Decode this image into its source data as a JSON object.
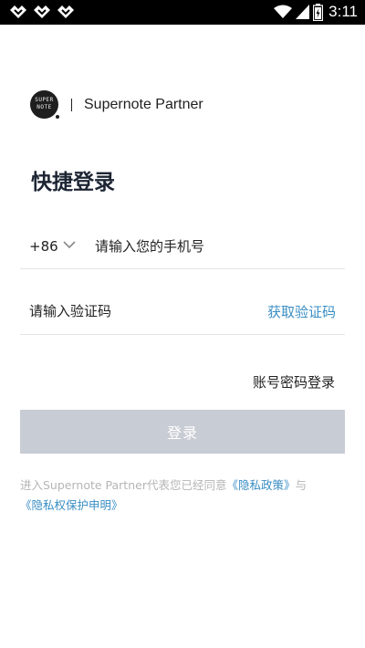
{
  "status_bar": {
    "time": "3:11",
    "notification_icons": [
      "app-notification-icon",
      "app-notification-icon",
      "app-notification-icon"
    ],
    "right_icons": [
      "wifi-icon",
      "signal-icon",
      "battery-icon"
    ]
  },
  "brand": {
    "logo_text_line1": "SUPER",
    "logo_text_line2": "NOTE",
    "app_name": "Supernote Partner"
  },
  "page": {
    "title": "快捷登录"
  },
  "phone": {
    "country_code": "+86",
    "placeholder": "请输入您的手机号"
  },
  "verification": {
    "placeholder": "请输入验证码",
    "get_code_label": "获取验证码"
  },
  "password_login_label": "账号密码登录",
  "login_button_label": "登录",
  "agreement": {
    "prefix": "进入Supernote Partner代表您已经同意",
    "privacy_policy_link": "《隐私政策》",
    "connector": "与",
    "privacy_protection_link": "《隐私权保护申明》"
  },
  "colors": {
    "link": "#3a8ec3",
    "button_disabled": "#c8ccd4",
    "title": "#1d2533",
    "status_bar_bg": "#000000"
  }
}
